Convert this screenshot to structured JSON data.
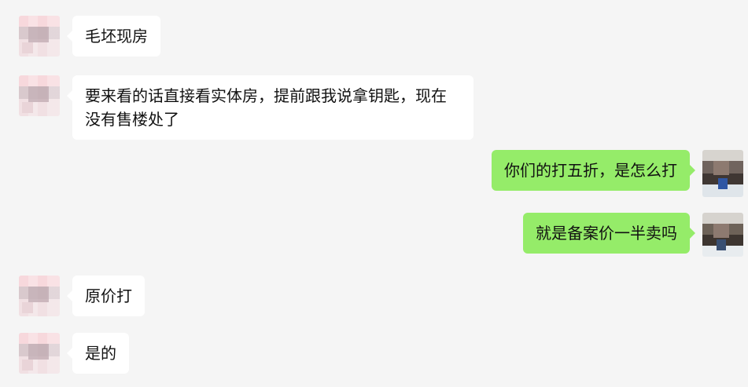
{
  "messages": [
    {
      "side": "left",
      "text": "毛坯现房"
    },
    {
      "side": "left",
      "text": "要来看的话直接看实体房，提前跟我说拿钥匙，现在没有售楼处了"
    },
    {
      "side": "right",
      "text": "你们的打五折，是怎么打"
    },
    {
      "side": "right",
      "text": "就是备案价一半卖吗"
    },
    {
      "side": "left",
      "text": "原价打"
    },
    {
      "side": "left",
      "text": "是的"
    }
  ],
  "colors": {
    "background": "#f5f5f5",
    "incoming_bubble": "#ffffff",
    "outgoing_bubble": "#95ec69",
    "text": "#111111"
  },
  "icons": {
    "incoming_avatar": "blurred-avatar-icon",
    "outgoing_avatar": "blurred-profile-photo-icon"
  }
}
